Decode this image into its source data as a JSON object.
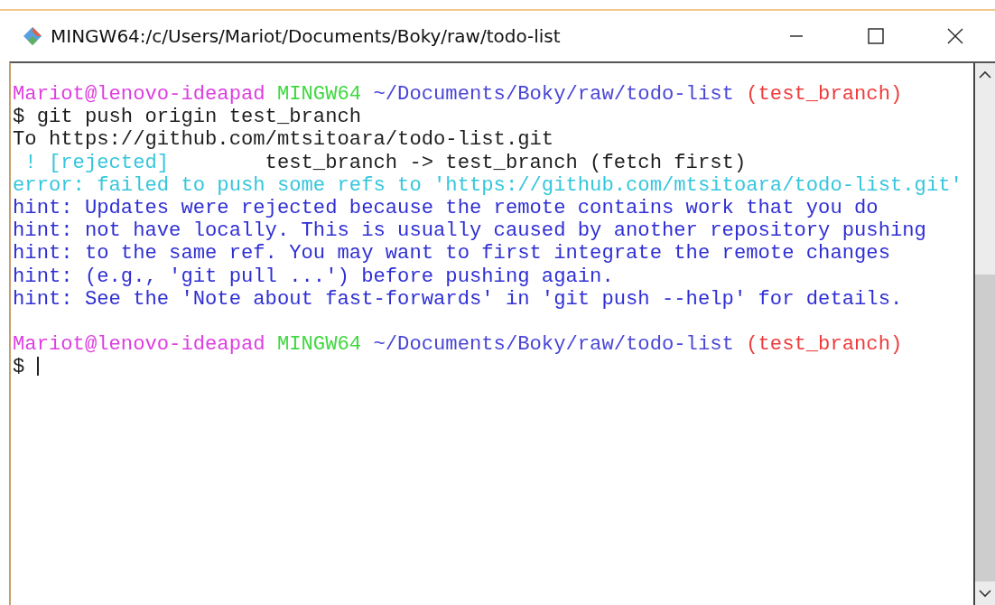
{
  "window": {
    "title": "MINGW64:/c/Users/Mariot/Documents/Boky/raw/todo-list"
  },
  "terminal": {
    "lines": [
      {
        "kind": "prompt",
        "segments": [
          {
            "kind": "user",
            "text": "Mariot@lenovo-ideapad"
          },
          {
            "kind": "host",
            "text": "MINGW64"
          },
          {
            "kind": "path",
            "text": "~/Documents/Boky/raw/todo-list"
          },
          {
            "kind": "branch",
            "text": "(test_branch)"
          }
        ]
      },
      {
        "kind": "output",
        "segments": [
          {
            "kind": "plain",
            "text": "$ git push origin test_branch"
          }
        ]
      },
      {
        "kind": "output",
        "segments": [
          {
            "kind": "plain",
            "text": "To https://github.com/mtsitoara/todo-list.git"
          }
        ]
      },
      {
        "kind": "output",
        "segments": [
          {
            "kind": "error",
            "text": " ! [rejected]"
          },
          {
            "kind": "plain",
            "text": "        test_branch -> test_branch (fetch first)"
          }
        ]
      },
      {
        "kind": "output",
        "segments": [
          {
            "kind": "error",
            "text": "error: failed to push some refs to 'https://github.com/mtsitoara/todo-list.git'"
          }
        ]
      },
      {
        "kind": "output",
        "segments": [
          {
            "kind": "hint",
            "text": "hint: Updates were rejected because the remote contains work that you do"
          }
        ]
      },
      {
        "kind": "output",
        "segments": [
          {
            "kind": "hint",
            "text": "hint: not have locally. This is usually caused by another repository pushing"
          }
        ]
      },
      {
        "kind": "output",
        "segments": [
          {
            "kind": "hint",
            "text": "hint: to the same ref. You may want to first integrate the remote changes"
          }
        ]
      },
      {
        "kind": "output",
        "segments": [
          {
            "kind": "hint",
            "text": "hint: (e.g., 'git pull ...') before pushing again."
          }
        ]
      },
      {
        "kind": "output",
        "segments": [
          {
            "kind": "hint",
            "text": "hint: See the 'Note about fast-forwards' in 'git push --help' for details."
          }
        ]
      },
      {
        "kind": "prompt",
        "blank_before": true,
        "segments": [
          {
            "kind": "user",
            "text": "Mariot@lenovo-ideapad"
          },
          {
            "kind": "host",
            "text": "MINGW64"
          },
          {
            "kind": "path",
            "text": "~/Documents/Boky/raw/todo-list"
          },
          {
            "kind": "branch",
            "text": "(test_branch)"
          }
        ]
      },
      {
        "kind": "output",
        "cursor": true,
        "segments": [
          {
            "kind": "plain",
            "text": "$"
          }
        ]
      }
    ]
  }
}
